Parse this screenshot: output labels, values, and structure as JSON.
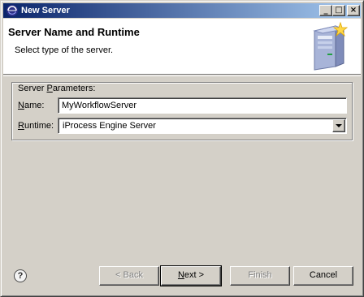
{
  "window": {
    "title": "New Server",
    "controls": {
      "minimize": "_",
      "maximize": "□",
      "close": "×"
    }
  },
  "banner": {
    "title": "Server Name and Runtime",
    "description": "Select type of the server."
  },
  "group": {
    "legend_prefix": "Server ",
    "legend_mnemonic": "P",
    "legend_rest": "arameters:"
  },
  "name_field": {
    "label_mnemonic": "N",
    "label_rest": "ame:",
    "value": "MyWorkflowServer"
  },
  "runtime_field": {
    "label_mnemonic": "R",
    "label_rest": "untime:",
    "selected": "iProcess Engine Server"
  },
  "buttons": {
    "help": "?",
    "back": "< Back",
    "next_mnemonic": "N",
    "next_rest": "ext >",
    "finish": "Finish",
    "cancel": "Cancel"
  },
  "colors": {
    "titlebar_start": "#0a246a",
    "titlebar_end": "#a6caf0",
    "face": "#d4d0c8"
  },
  "icons": {
    "title": "eclipse-icon",
    "banner": "server-wizard-icon"
  }
}
